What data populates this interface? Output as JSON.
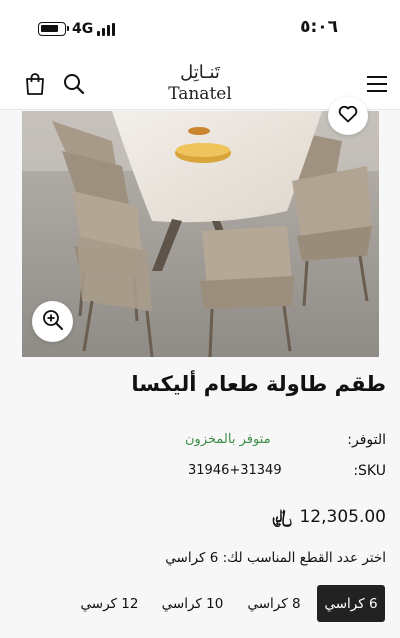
{
  "status_bar": {
    "time": "٥:٠٦",
    "network": "4G"
  },
  "header": {
    "logo_arabic": "تَنـاتِل",
    "logo_latin": "Tanatel"
  },
  "icons": {
    "menu": "hamburger-menu-icon",
    "search": "search-icon",
    "cart": "shopping-bag-icon",
    "wishlist": "heart-icon",
    "zoom": "zoom-in-icon"
  },
  "product": {
    "title": "طقم طاولة طعام أليكسا",
    "availability_label": "التوفر:",
    "availability_value": "متوفر بالمخزون",
    "sku_label": "SKU:",
    "sku_value": "31946+31349",
    "price": "12,305.00",
    "currency_symbol": "﷼"
  },
  "options": {
    "prompt": "اختر عدد القطع المناسب لك: 6 كراسي",
    "items": [
      {
        "label": "6 كراسي",
        "selected": true
      },
      {
        "label": "8 كراسي",
        "selected": false
      },
      {
        "label": "10 كراسي",
        "selected": false
      },
      {
        "label": "12 كرسي",
        "selected": false
      }
    ]
  },
  "colors": {
    "in_stock": "#3e8e4a",
    "selected_option_bg": "#222222",
    "page_bg": "#f7f7f7"
  }
}
